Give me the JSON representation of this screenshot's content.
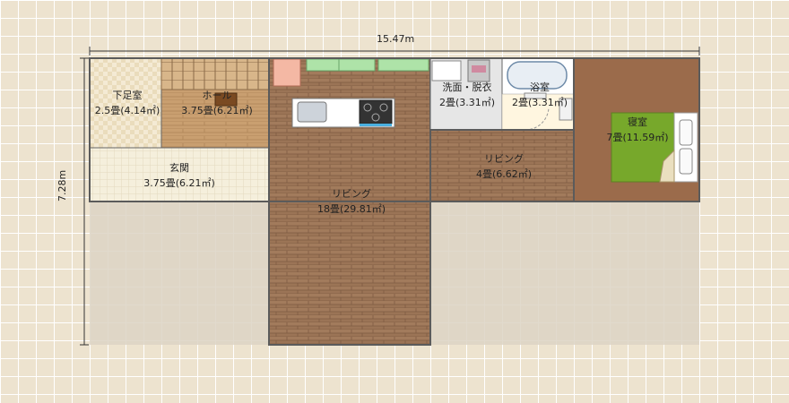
{
  "dimensions": {
    "width": "15.47m",
    "height": "7.28m"
  },
  "rooms": [
    {
      "id": "shoe-room",
      "name": "下足室",
      "size": "2.5畳(4.14㎡)"
    },
    {
      "id": "hall",
      "name": "ホール",
      "size": "3.75畳(6.21㎡)"
    },
    {
      "id": "entrance",
      "name": "玄関",
      "size": "3.75畳(6.21㎡)"
    },
    {
      "id": "living-main",
      "name": "リビング",
      "size": "18畳(29.81㎡)"
    },
    {
      "id": "washroom",
      "name": "洗面・脱衣",
      "size": "2畳(3.31㎡)"
    },
    {
      "id": "bathroom",
      "name": "浴室",
      "size": "2畳(3.31㎡)"
    },
    {
      "id": "living-small",
      "name": "リビング",
      "size": "4畳(6.62㎡)"
    },
    {
      "id": "bedroom",
      "name": "寝室",
      "size": "7畳(11.59㎡)"
    }
  ],
  "colors": {
    "wood_floor": "#9a7355",
    "tatami_green": "#77a82b",
    "tile_floor": "#f3ecd6",
    "wall": "#5b5b5b",
    "outside_area": "#dcd4c4"
  }
}
